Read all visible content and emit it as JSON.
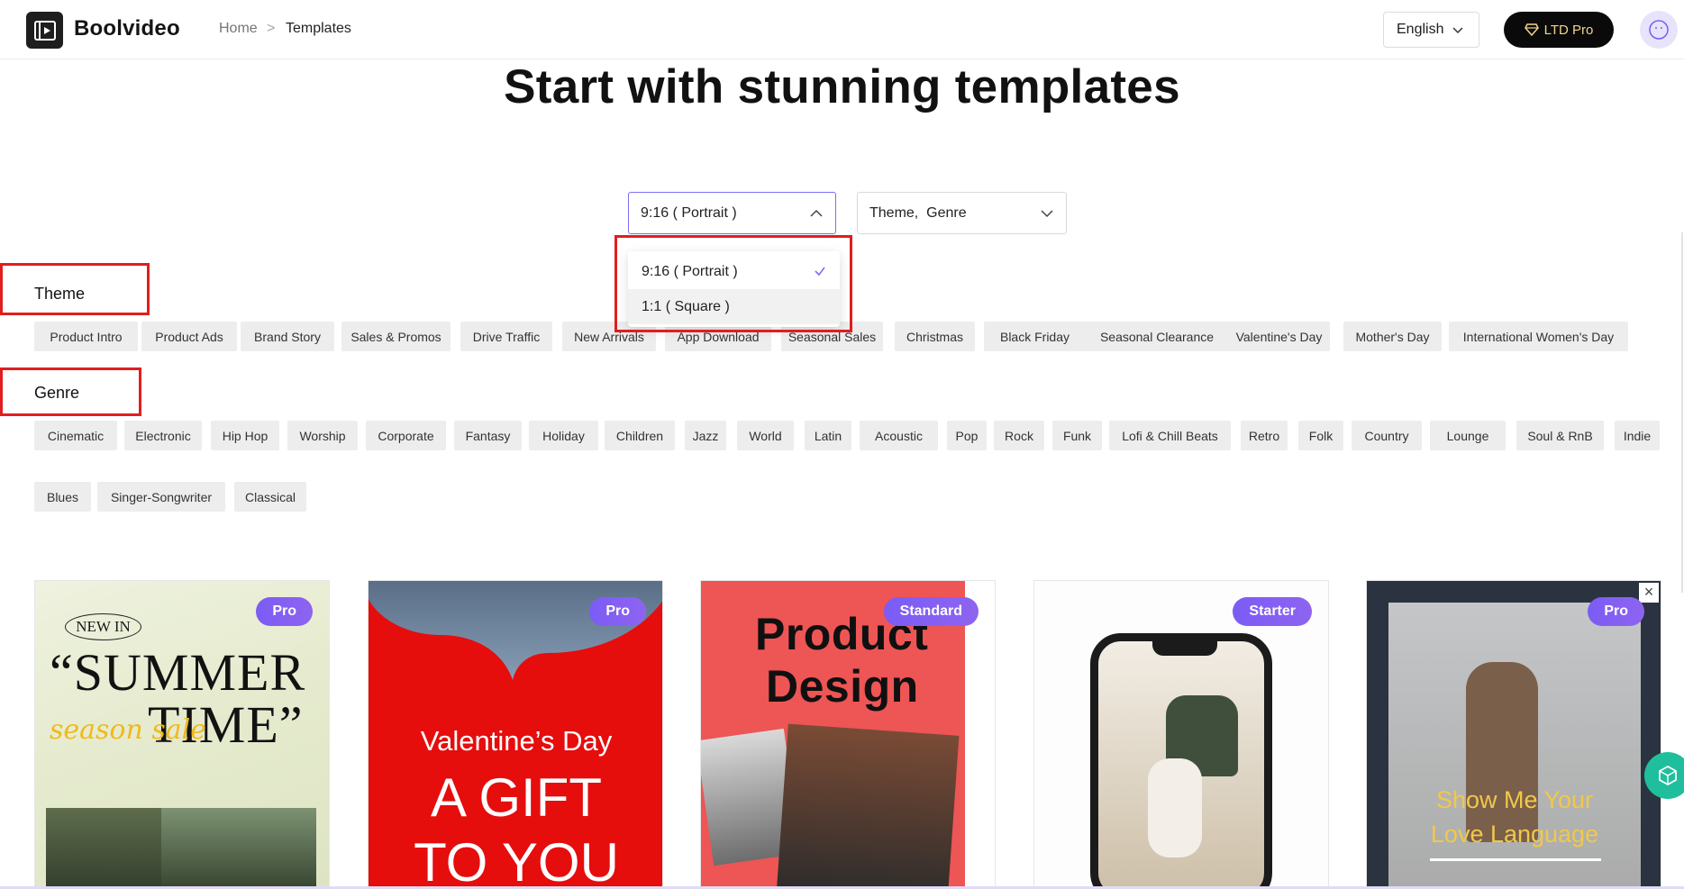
{
  "header": {
    "brand": "Boolvideo",
    "breadcrumb": {
      "home": "Home",
      "separator": ">",
      "current": "Templates"
    },
    "language": "English",
    "pro_label": "LTD Pro"
  },
  "page": {
    "title": "Start with stunning templates"
  },
  "filters": {
    "ratio_selected": "9:16 ( Portrait )",
    "ratio_options": [
      "9:16 ( Portrait )",
      "1:1 ( Square )"
    ],
    "theme_genre_value": "Theme,  Genre"
  },
  "theme": {
    "label": "Theme",
    "tags": [
      "Product Intro",
      "Product Ads",
      "Brand Story",
      "Sales & Promos",
      "Drive Traffic",
      "New Arrivals",
      "App Download",
      "Seasonal Sales",
      "Christmas",
      "Black Friday",
      "Seasonal Clearance",
      "Valentine's Day",
      "Mother's Day",
      "International Women's Day"
    ]
  },
  "genre": {
    "label": "Genre",
    "tags": [
      "Cinematic",
      "Electronic",
      "Hip Hop",
      "Worship",
      "Corporate",
      "Fantasy",
      "Holiday",
      "Children",
      "Jazz",
      "World",
      "Latin",
      "Acoustic",
      "Pop",
      "Rock",
      "Funk",
      "Lofi & Chill Beats",
      "Retro",
      "Folk",
      "Country",
      "Lounge",
      "Soul & RnB",
      "Indie",
      "Blues",
      "Singer-Songwriter",
      "Classical"
    ]
  },
  "cards": [
    {
      "badge": "Pro",
      "texts": [
        "NEW IN",
        "“SUMMER",
        "TIME”",
        "season sale"
      ]
    },
    {
      "badge": "Pro",
      "texts": [
        "Valentine’s Day",
        "A GIFT",
        "TO YOU"
      ]
    },
    {
      "badge": "Standard",
      "texts": [
        "Product",
        "Design"
      ]
    },
    {
      "badge": "Starter",
      "texts": []
    },
    {
      "badge": "Pro",
      "texts": [
        "Show Me Your",
        "Love Language"
      ]
    }
  ],
  "colors": {
    "accent": "#7b5cf5",
    "annotation_red": "#e01e1e",
    "tag_bg": "#ededed"
  },
  "icons": {
    "logo": "play-frame-icon",
    "chevron": "chevron-down-icon",
    "diamond": "diamond-icon",
    "check": "check-icon",
    "float": "cube-icon"
  }
}
